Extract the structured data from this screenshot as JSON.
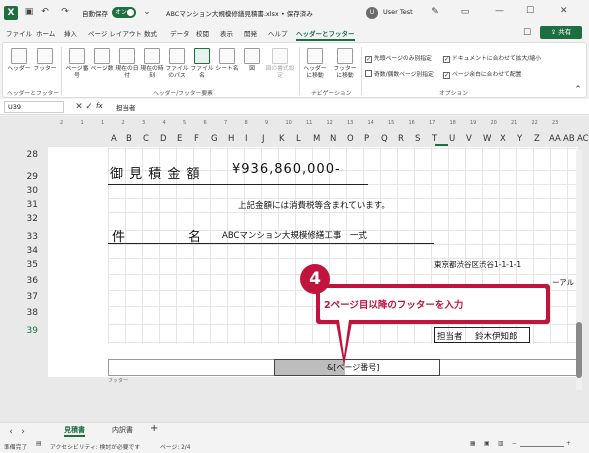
{
  "titlebar": {
    "autosave_label": "自動保存",
    "toggle_label": "オン",
    "doc_title": "ABCマンション大規模修繕見積書.xlsx • 保存済み",
    "user": "User Test",
    "win_min": "—",
    "win_max": "☐",
    "win_close": "✕"
  },
  "menu": {
    "tabs": [
      "ファイル",
      "ホーム",
      "挿入",
      "ページ レイアウト",
      "数式",
      "データ",
      "校閲",
      "表示",
      "開発",
      "ヘルプ",
      "ヘッダーとフッター"
    ],
    "share": "共有"
  },
  "ribbon": {
    "hf_buttons": [
      "ヘッダー",
      "フッター"
    ],
    "hf_group": "ヘッダーとフッター",
    "elem_buttons": [
      "ページ番号",
      "ページ数",
      "現在の日付",
      "現在の時刻",
      "ファイルのパス",
      "ファイル名",
      "シート名",
      "図",
      "図の書式設定"
    ],
    "elem_group": "ヘッダー/フッター要素",
    "nav_buttons": [
      "ヘッダーに移動",
      "フッターに移動"
    ],
    "nav_group": "ナビゲーション",
    "options": [
      "先頭ページのみ別指定",
      "奇数/偶数ページ別指定",
      "ドキュメントに合わせて拡大/縮小",
      "ページ余白に合わせて配置"
    ],
    "options_group": "オプション"
  },
  "formula": {
    "namebox": "U39",
    "fx": "fx",
    "value": "担当者"
  },
  "columns": [
    "A",
    "B",
    "C",
    "D",
    "E",
    "F",
    "G",
    "H",
    "I",
    "J",
    "K",
    "L",
    "M",
    "N",
    "O",
    "P",
    "Q",
    "R",
    "S",
    "T",
    "U",
    "V",
    "W",
    "X",
    "Y",
    "Z",
    "AA",
    "AB",
    "AC"
  ],
  "ruler_marks": [
    "2",
    "1",
    "1",
    "2",
    "3",
    "4",
    "5",
    "6",
    "7",
    "8",
    "9",
    "10",
    "11",
    "12",
    "13",
    "14",
    "15",
    "16",
    "17",
    "18",
    "19",
    "20",
    "21",
    "22",
    "23"
  ],
  "rows": [
    "28",
    "29",
    "30",
    "31",
    "32",
    "33",
    "34",
    "35",
    "36",
    "37",
    "38",
    "39"
  ],
  "content": {
    "estimate_label": "御 見 積 金 額",
    "estimate_value": "¥936,860,000-",
    "tax_note": "上記金額には消費税等含まれています。",
    "subject_a": "件",
    "subject_b": "名",
    "subject_value": "ABCマンション大規模修繕工事　一式",
    "address": "東京都渋谷区渋谷1-1-1-1",
    "company_partial": "ーアル",
    "person_label": "担当者",
    "person_name": "鈴木伊知郎"
  },
  "footer": {
    "center_text": "&[ページ番号]",
    "label": "フッター"
  },
  "callout": {
    "badge": "4",
    "text": "2ページ目以降のフッターを入力"
  },
  "sheet_tabs": [
    "見積書",
    "内訳書"
  ],
  "status": {
    "ready": "準備完了",
    "accessibility": "アクセシビリティ: 検討が必要です",
    "page": "ページ: 2/4"
  }
}
